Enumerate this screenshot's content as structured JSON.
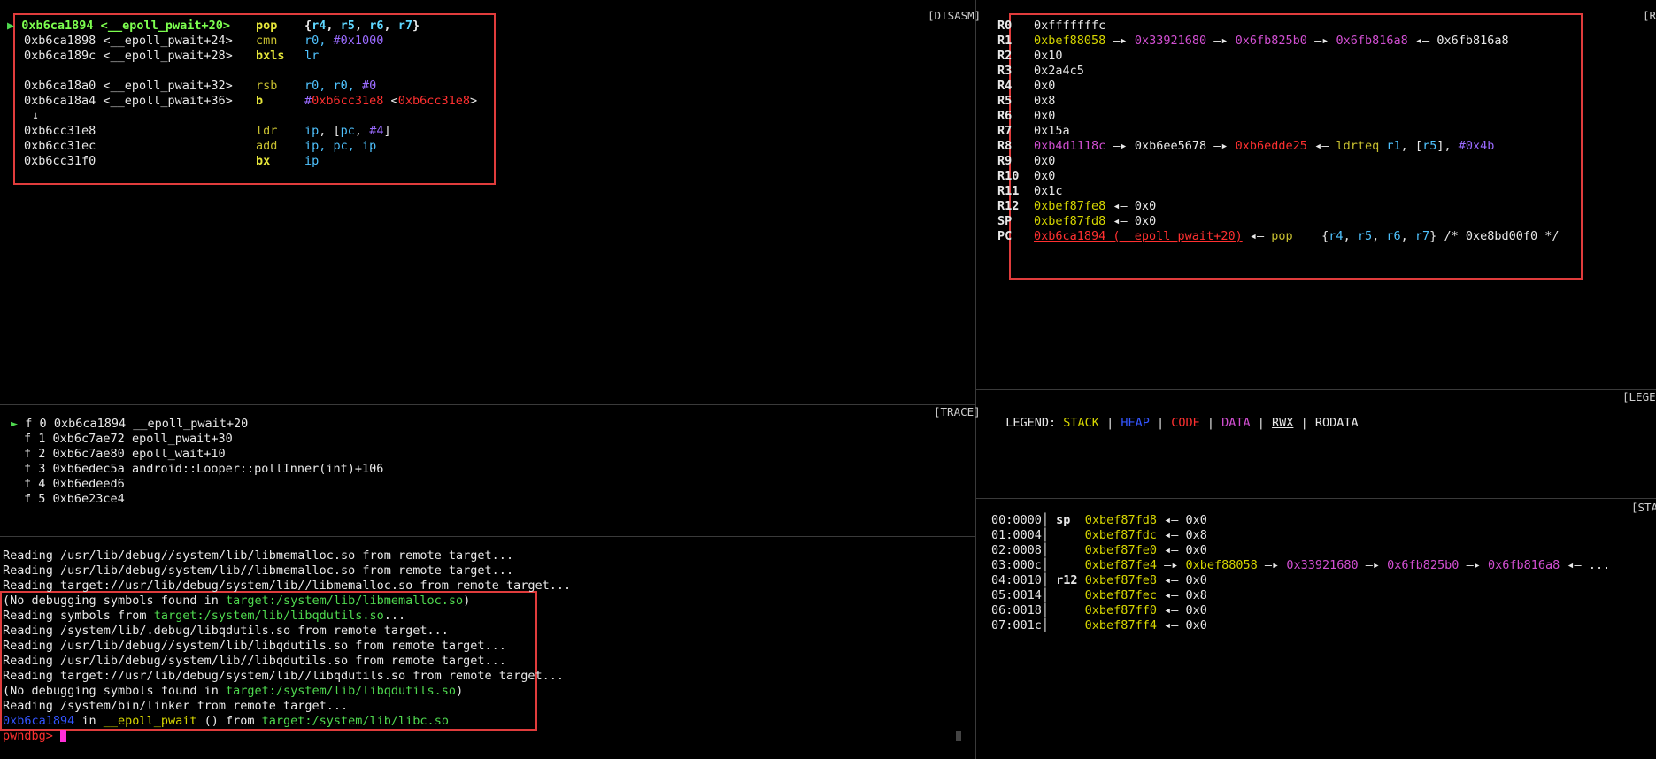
{
  "headers": {
    "disasm": "[DISASM]",
    "regs": "[R",
    "trace": "[TRACE]",
    "legend": "[LEGEN",
    "stack": "[STA"
  },
  "disasm": {
    "current_marker": "▶",
    "rows": [
      {
        "addr": "0xb6ca1894 <__epoll_pwait+20>",
        "mnem": "pop",
        "ops": "{r4, r5, r6, r7}"
      },
      {
        "addr": "0xb6ca1898 <__epoll_pwait+24>",
        "mnem": "cmn",
        "ops_reg": "r0,",
        "ops_imm": "#0x1000"
      },
      {
        "addr": "0xb6ca189c <__epoll_pwait+28>",
        "mnem": "bxls",
        "ops": "lr"
      },
      {
        "addr": "0xb6ca18a0 <__epoll_pwait+32>",
        "mnem": "rsb",
        "ops_reg": "r0, r0,",
        "ops_imm": "#0"
      },
      {
        "addr": "0xb6ca18a4 <__epoll_pwait+36>",
        "mnem": "b",
        "target_hash": "#",
        "target": "0xb6cc31e8",
        "target_open": " <",
        "target2": "0xb6cc31e8",
        "target_close": ">"
      },
      {
        "arrow": "↓"
      },
      {
        "addr": "0xb6cc31e8",
        "mnem": "ldr",
        "ops": "ip, [pc, #4]"
      },
      {
        "addr": "0xb6cc31ec",
        "mnem": "add",
        "ops": "ip, pc, ip"
      },
      {
        "addr": "0xb6cc31f0",
        "mnem": "bx",
        "ops": "ip"
      }
    ]
  },
  "regs": [
    {
      "name": "R0",
      "val": "0xfffffffc"
    },
    {
      "name": "R1",
      "val": "0xbef88058",
      "chain": [
        "0x33921680",
        "0x6fb825b0",
        "0x6fb816a8"
      ],
      "tail": "0x6fb816a8"
    },
    {
      "name": "R2",
      "val": "0x10"
    },
    {
      "name": "R3",
      "val": "0x2a4c5"
    },
    {
      "name": "R4",
      "val": "0x0"
    },
    {
      "name": "R5",
      "val": "0x8"
    },
    {
      "name": "R6",
      "val": "0x0"
    },
    {
      "name": "R7",
      "val": "0x15a"
    },
    {
      "name": "R8",
      "val": "0xb4d1118c",
      "chain2": "0xb6ee5678",
      "chain3": "0xb6edde25",
      "instr": "ldrteq",
      "instr_ops": "r1, [r5], #0x4b"
    },
    {
      "name": "R9",
      "val": "0x0"
    },
    {
      "name": "R10",
      "val": "0x0"
    },
    {
      "name": "R11",
      "val": "0x1c"
    },
    {
      "name": "R12",
      "val": "0xbef87fe8",
      "tail": "0x0"
    },
    {
      "name": "SP",
      "val": "0xbef87fd8",
      "tail": "0x0"
    },
    {
      "name": "PC",
      "val": "0xb6ca1894 (__epoll_pwait+20)",
      "instr": "pop",
      "instr_ops": "{r4, r5, r6, r7}",
      "comment": "/* 0xe8bd00f0 */"
    }
  ],
  "trace": [
    {
      "marker": "►",
      "frame": "f 0",
      "addr": "0xb6ca1894",
      "sym": "__epoll_pwait+20"
    },
    {
      "marker": "",
      "frame": "f 1",
      "addr": "0xb6c7ae72",
      "sym": "epoll_pwait+30"
    },
    {
      "marker": "",
      "frame": "f 2",
      "addr": "0xb6c7ae80",
      "sym": "epoll_wait+10"
    },
    {
      "marker": "",
      "frame": "f 3",
      "addr": "0xb6edec5a",
      "sym": "android::Looper::pollInner(int)+106"
    },
    {
      "marker": "",
      "frame": "f 4",
      "addr": "0xb6edeed6",
      "sym": ""
    },
    {
      "marker": "",
      "frame": "f 5",
      "addr": "0xb6e23ce4",
      "sym": ""
    }
  ],
  "console": {
    "l1": "Reading /usr/lib/debug//system/lib/libmemalloc.so from remote target...",
    "l2": "Reading /usr/lib/debug/system/lib//libmemalloc.so from remote target...",
    "l3": "Reading target://usr/lib/debug/system/lib//libmemalloc.so from remote target...",
    "l4a": "(No debugging symbols found in ",
    "l4b": "target:/system/lib/libmemalloc.so",
    "l4c": ")",
    "l5a": "Reading symbols from ",
    "l5b": "target:/system/lib/libqdutils.so",
    "l5c": "...",
    "l6": "Reading /system/lib/.debug/libqdutils.so from remote target...",
    "l7": "Reading /usr/lib/debug//system/lib/libqdutils.so from remote target...",
    "l8": "Reading /usr/lib/debug/system/lib//libqdutils.so from remote target...",
    "l9": "Reading target://usr/lib/debug/system/lib//libqdutils.so from remote target...",
    "l10a": "(No debugging symbols found in ",
    "l10b": "target:/system/lib/libqdutils.so",
    "l10c": ")",
    "l11": "Reading /system/bin/linker from remote target...",
    "l12a": "0xb6ca1894",
    "l12b": " in ",
    "l12c": "__epoll_pwait",
    "l12d": " () from ",
    "l12e": "target:/system/lib/libc.so",
    "prompt": "pwndbg> "
  },
  "legend": {
    "label": "LEGEND: ",
    "stack": "STACK",
    "heap": "HEAP",
    "code": "CODE",
    "data": "DATA",
    "rwx": "RWX",
    "rodata": "RODATA",
    "sep": " | "
  },
  "stack": [
    {
      "idx": "00:0000│",
      "reg": "sp",
      "addr": "0xbef87fd8",
      "rest": "0x0"
    },
    {
      "idx": "01:0004│",
      "reg": "",
      "addr": "0xbef87fdc",
      "rest": "0x8"
    },
    {
      "idx": "02:0008│",
      "reg": "",
      "addr": "0xbef87fe0",
      "rest": "0x0"
    },
    {
      "idx": "03:000c│",
      "reg": "",
      "addr": "0xbef87fe4",
      "chain": true,
      "c1": "0xbef88058",
      "c2": "0x33921680",
      "c3": "0x6fb825b0",
      "c4": "0x6fb816a8",
      "ellipsis": "..."
    },
    {
      "idx": "04:0010│",
      "reg": "r12",
      "addr": "0xbef87fe8",
      "rest": "0x0"
    },
    {
      "idx": "05:0014│",
      "reg": "",
      "addr": "0xbef87fec",
      "rest": "0x8"
    },
    {
      "idx": "06:0018│",
      "reg": "",
      "addr": "0xbef87ff0",
      "rest": "0x0"
    },
    {
      "idx": "07:001c│",
      "reg": "",
      "addr": "0xbef87ff4",
      "rest": "0x0"
    }
  ],
  "arrows": {
    "right": "—▸",
    "left": "◂—"
  }
}
